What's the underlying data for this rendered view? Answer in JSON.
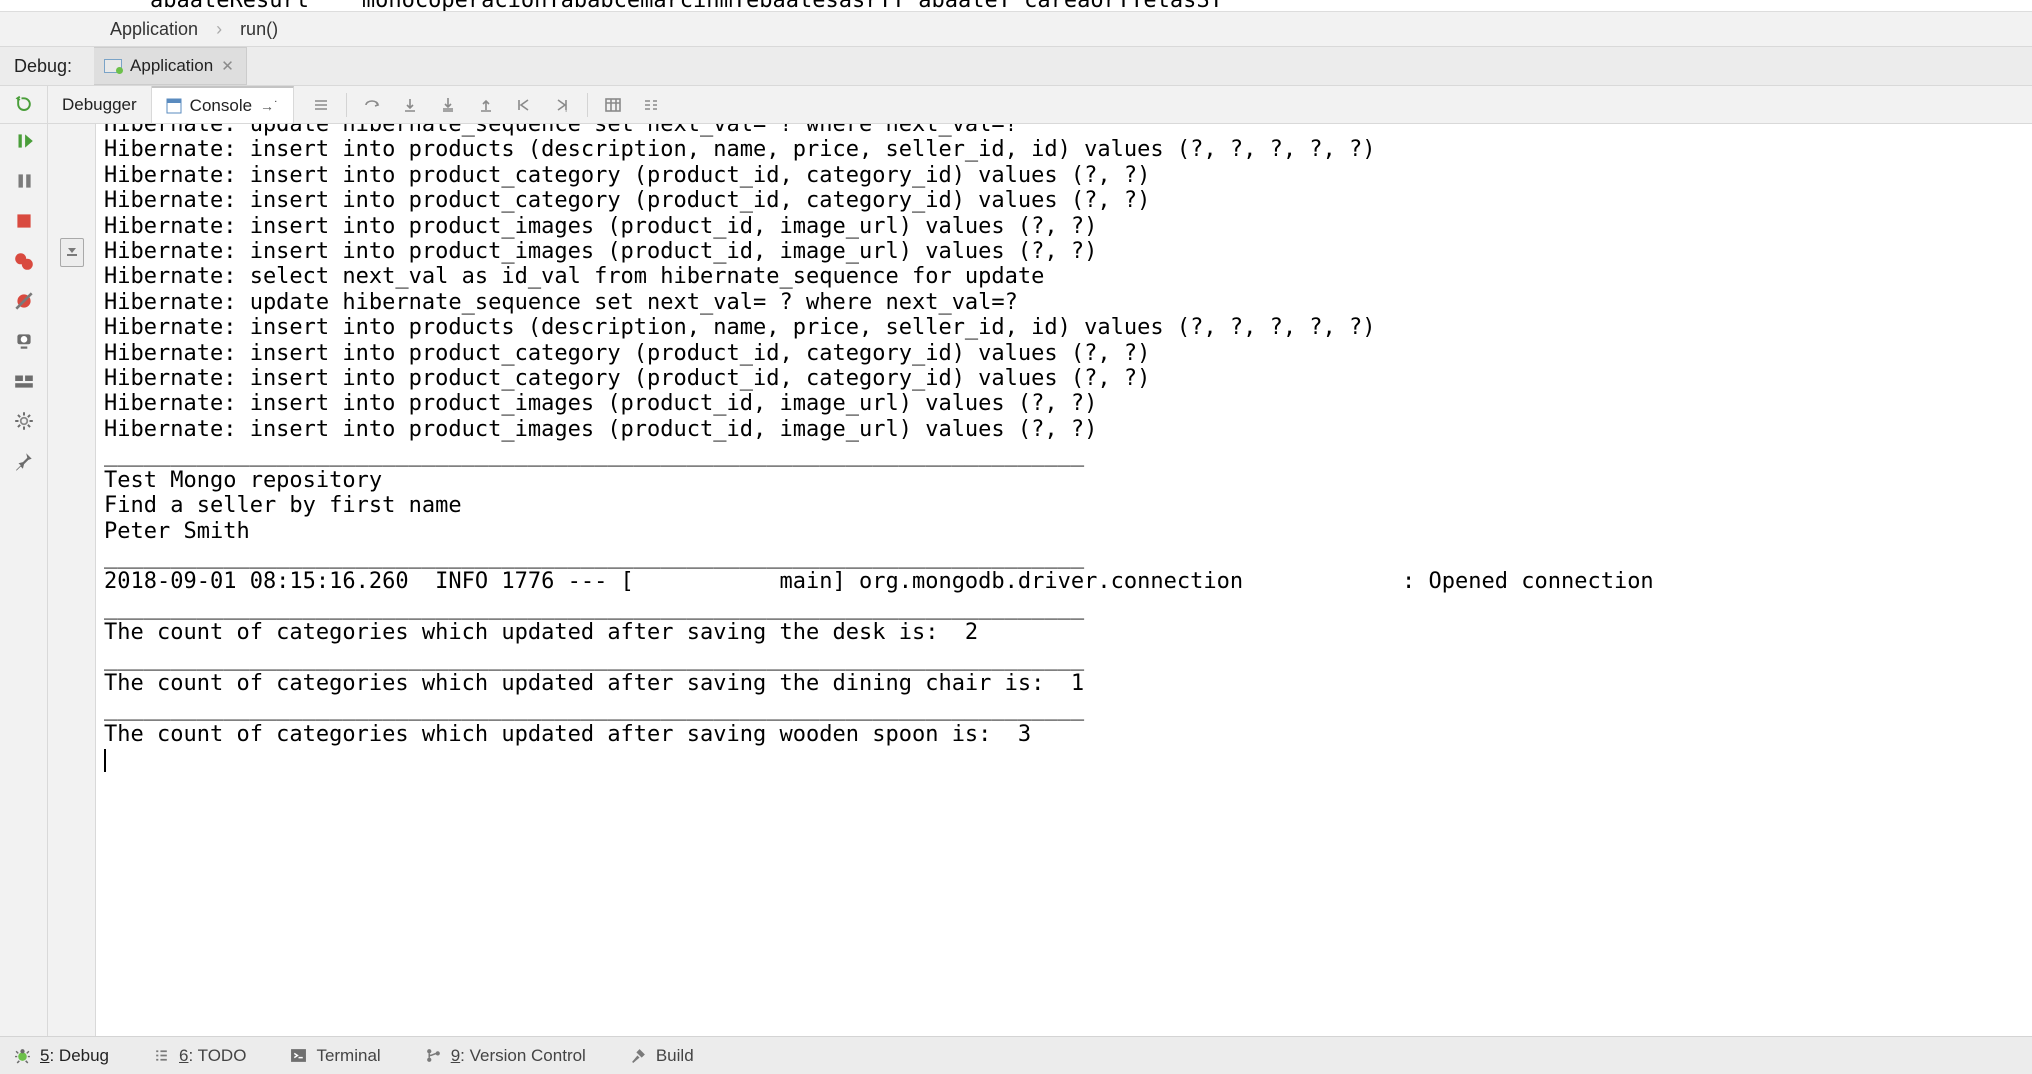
{
  "topcut": "abaateResurt    monocoperacionTababcemarcinmTebaatesasrTT abaateT careaorTTetasST",
  "breadcrumb": {
    "item1": "Application",
    "item2": "run()"
  },
  "debugStrip": {
    "label": "Debug:",
    "tabName": "Application"
  },
  "toolbar": {
    "tabDebugger": "Debugger",
    "tabConsole": "Console"
  },
  "consoleLines": [
    "Hibernate: update hibernate_sequence set next_val= ? where next_val=?",
    "Hibernate: insert into products (description, name, price, seller_id, id) values (?, ?, ?, ?, ?)",
    "Hibernate: insert into product_category (product_id, category_id) values (?, ?)",
    "Hibernate: insert into product_category (product_id, category_id) values (?, ?)",
    "Hibernate: insert into product_images (product_id, image_url) values (?, ?)",
    "Hibernate: insert into product_images (product_id, image_url) values (?, ?)",
    "Hibernate: select next_val as id_val from hibernate_sequence for update",
    "Hibernate: update hibernate_sequence set next_val= ? where next_val=?",
    "Hibernate: insert into products (description, name, price, seller_id, id) values (?, ?, ?, ?, ?)",
    "Hibernate: insert into product_category (product_id, category_id) values (?, ?)",
    "Hibernate: insert into product_category (product_id, category_id) values (?, ?)",
    "Hibernate: insert into product_images (product_id, image_url) values (?, ?)",
    "Hibernate: insert into product_images (product_id, image_url) values (?, ?)",
    "__________________________________________________________________________",
    "Test Mongo repository",
    "Find a seller by first name",
    "Peter Smith",
    "__________________________________________________________________________",
    "2018-09-01 08:15:16.260  INFO 1776 --- [           main] org.mongodb.driver.connection            : Opened connection",
    "__________________________________________________________________________",
    "The count of categories which updated after saving the desk is:  2",
    "__________________________________________________________________________",
    "The count of categories which updated after saving the dining chair is:  1",
    "__________________________________________________________________________",
    "The count of categories which updated after saving wooden spoon is:  3"
  ],
  "bottom": {
    "debug": "5: Debug",
    "todo": "6: TODO",
    "terminal": "Terminal",
    "vcs": "9: Version Control",
    "build": "Build"
  }
}
